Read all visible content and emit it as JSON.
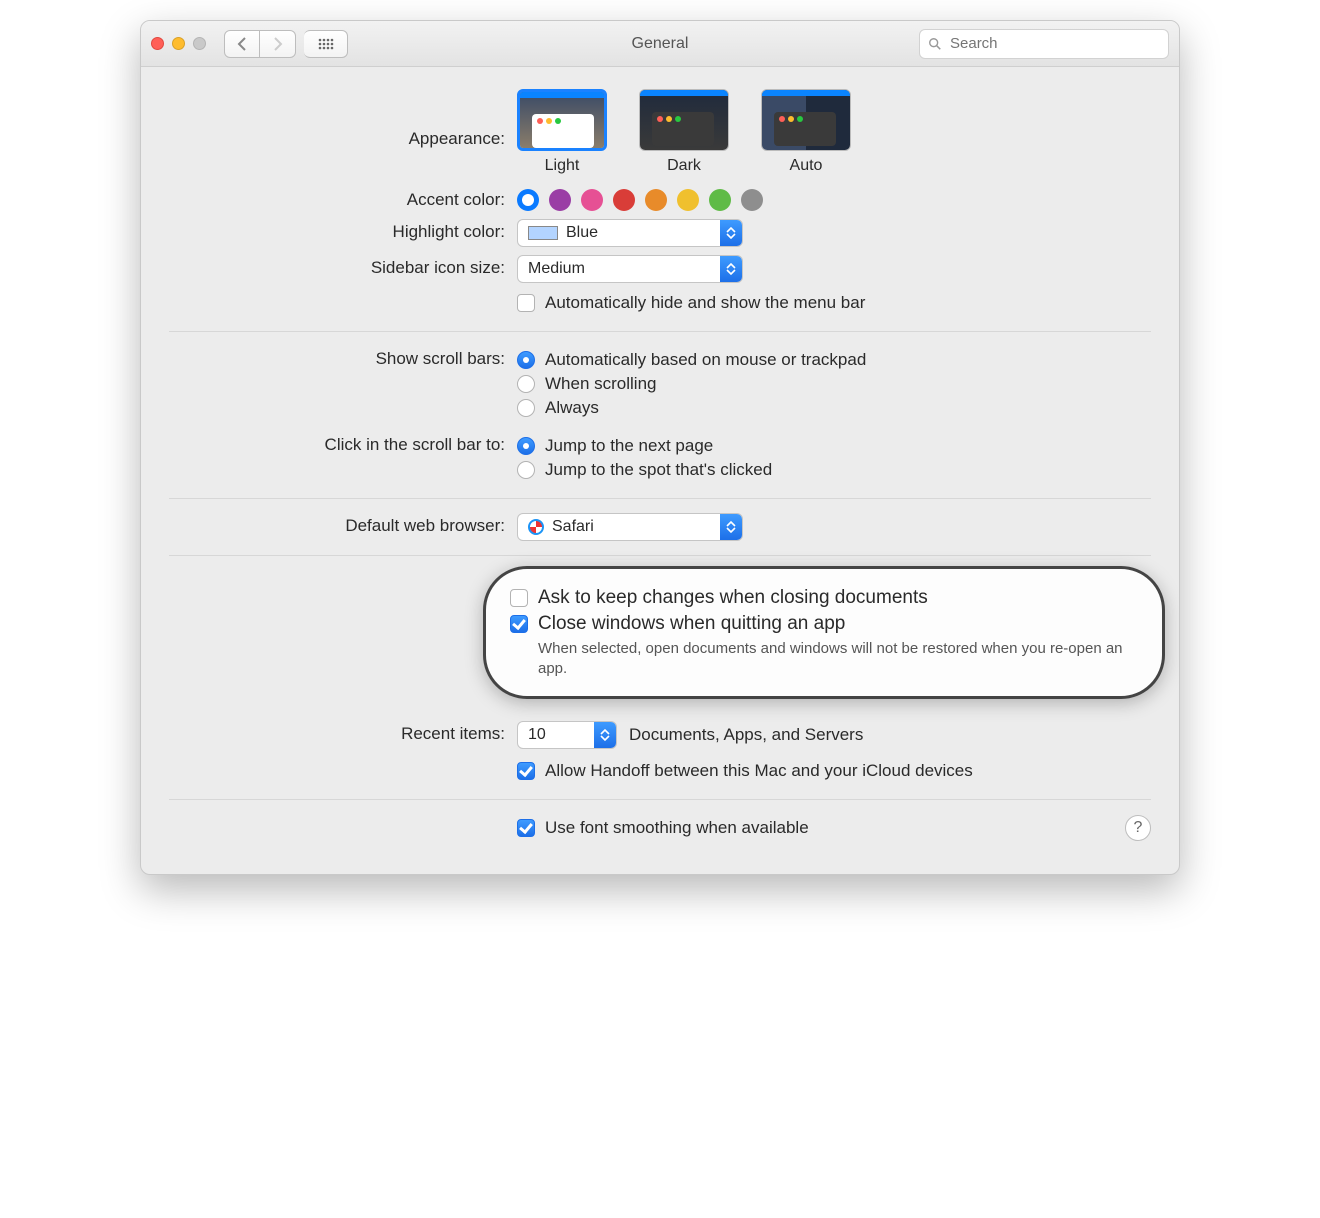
{
  "titlebar": {
    "title": "General",
    "search_placeholder": "Search"
  },
  "appearance": {
    "label": "Appearance:",
    "options": [
      "Light",
      "Dark",
      "Auto"
    ],
    "selected": "Light"
  },
  "accent": {
    "label": "Accent color:",
    "colors": [
      "#0a7aff",
      "#9a3ea5",
      "#e65094",
      "#d93d38",
      "#e88b2a",
      "#f0c02e",
      "#5fbb46",
      "#8e8e8e"
    ],
    "selected_index": 0
  },
  "highlight": {
    "label": "Highlight color:",
    "value": "Blue"
  },
  "sidebar_size": {
    "label": "Sidebar icon size:",
    "value": "Medium"
  },
  "auto_hide_menubar": {
    "label": "Automatically hide and show the menu bar",
    "checked": false
  },
  "scrollbars": {
    "label": "Show scroll bars:",
    "options": [
      "Automatically based on mouse or trackpad",
      "When scrolling",
      "Always"
    ],
    "selected_index": 0
  },
  "click_scrollbar": {
    "label": "Click in the scroll bar to:",
    "options": [
      "Jump to the next page",
      "Jump to the spot that's clicked"
    ],
    "selected_index": 0
  },
  "default_browser": {
    "label": "Default web browser:",
    "value": "Safari"
  },
  "ask_keep_changes": {
    "label": "Ask to keep changes when closing documents",
    "checked": false
  },
  "close_windows": {
    "label": "Close windows when quitting an app",
    "checked": true,
    "sub": "When selected, open documents and windows will not be restored when you re-open an app."
  },
  "recent_items": {
    "label": "Recent items:",
    "value": "10",
    "suffix": "Documents, Apps, and Servers"
  },
  "handoff": {
    "label": "Allow Handoff between this Mac and your iCloud devices",
    "checked": true
  },
  "font_smoothing": {
    "label": "Use font smoothing when available",
    "checked": true
  }
}
